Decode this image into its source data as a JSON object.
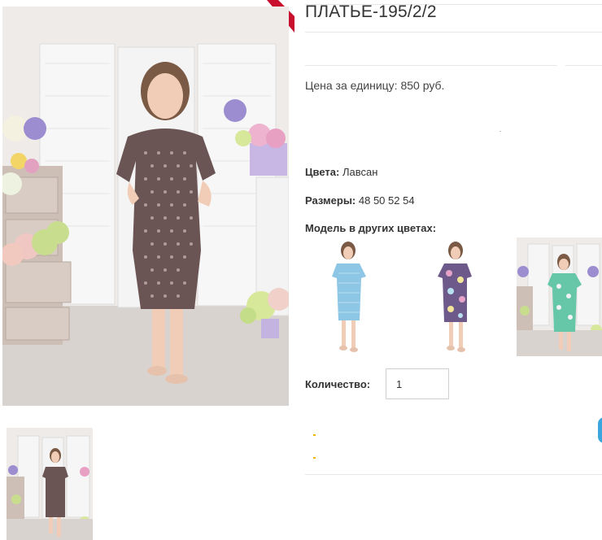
{
  "product": {
    "title": "ПЛАТЬЕ-195/2/2",
    "price_text": "Цена за единицу: 850 руб.",
    "colors_label": "Цвета:",
    "colors_value": "Лавсан",
    "sizes_label": "Размеры:",
    "sizes_value": "48 50 52 54",
    "other_colors_label": "Модель в других цветах:",
    "quantity_label": "Количество:",
    "quantity_value": "1"
  },
  "images": {
    "main_alt": "Платье-195/2/2 — серо-бордовое с геометрическим принтом",
    "color_variants": [
      {
        "name": "light-blue-dress",
        "color": "#8ec6e6"
      },
      {
        "name": "floral-purple-dress",
        "color": "#6e5a8a"
      },
      {
        "name": "mint-floral-dress",
        "color": "#66c6a8"
      }
    ]
  },
  "colors": {
    "accent": "#c8102e",
    "dress_main": "#6b5454",
    "highlight": "#f0b400"
  }
}
